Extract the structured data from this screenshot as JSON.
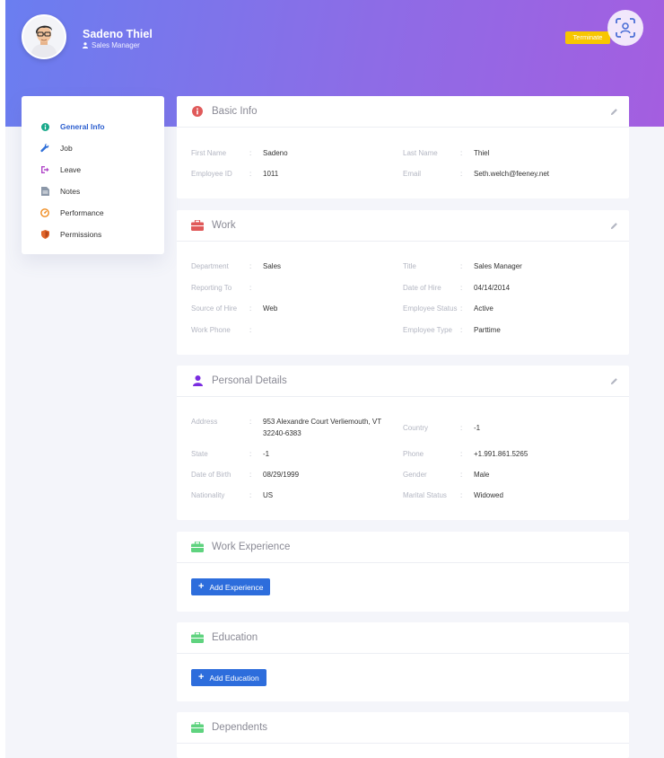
{
  "header": {
    "user_name": "Sadeno Thiel",
    "user_role": "Sales Manager",
    "terminate_label": "Terminate"
  },
  "sidenav": {
    "items": [
      {
        "label": "General Info",
        "icon": "info-circle-icon",
        "color": "#19a98b",
        "active": true
      },
      {
        "label": "Job",
        "icon": "wrench-icon",
        "color": "#2f6fd8",
        "active": false
      },
      {
        "label": "Leave",
        "icon": "sign-out-icon",
        "color": "#b148c9",
        "active": false
      },
      {
        "label": "Notes",
        "icon": "notes-icon",
        "color": "#8b97a8",
        "active": false
      },
      {
        "label": "Performance",
        "icon": "gauge-icon",
        "color": "#f08a1c",
        "active": false
      },
      {
        "label": "Permissions",
        "icon": "shield-icon",
        "color": "#e0662b",
        "active": false
      }
    ]
  },
  "basic_info": {
    "title": "Basic Info",
    "first_name_label": "First Name",
    "first_name": "Sadeno",
    "last_name_label": "Last Name",
    "last_name": "Thiel",
    "employee_id_label": "Employee ID",
    "employee_id": "1011",
    "email_label": "Email",
    "email": "Seth.welch@feeney.net"
  },
  "work": {
    "title": "Work",
    "department_label": "Department",
    "department": "Sales",
    "title_label": "Title",
    "job_title": "Sales Manager",
    "reporting_to_label": "Reporting To",
    "reporting_to": "",
    "date_of_hire_label": "Date of Hire",
    "date_of_hire": "04/14/2014",
    "source_of_hire_label": "Source of Hire",
    "source_of_hire": "Web",
    "employee_status_label": "Employee Status",
    "employee_status": "Active",
    "work_phone_label": "Work Phone",
    "work_phone": "",
    "employee_type_label": "Employee Type",
    "employee_type": "Parttime"
  },
  "personal": {
    "title": "Personal Details",
    "address_label": "Address",
    "address_line1": "953 Alexandre Court Verliemouth, VT",
    "address_line2": "32240-6383",
    "country_label": "Country",
    "country": "-1",
    "state_label": "State",
    "state": "-1",
    "phone_label": "Phone",
    "phone": "+1.991.861.5265",
    "dob_label": "Date of Birth",
    "dob": "08/29/1999",
    "gender_label": "Gender",
    "gender": "Male",
    "nationality_label": "Nationality",
    "nationality": "US",
    "marital_label": "Marital Status",
    "marital": "Widowed"
  },
  "experience": {
    "title": "Work Experience",
    "button_label": "Add Experience"
  },
  "education": {
    "title": "Education",
    "button_label": "Add Education"
  },
  "dependents": {
    "title": "Dependents"
  },
  "colors": {
    "accent": "#2d6ddc",
    "terminate": "#f7c600",
    "section_icon_red": "#e05a5a",
    "section_icon_purple": "#7a2ce0",
    "section_icon_green": "#5fd37f"
  }
}
